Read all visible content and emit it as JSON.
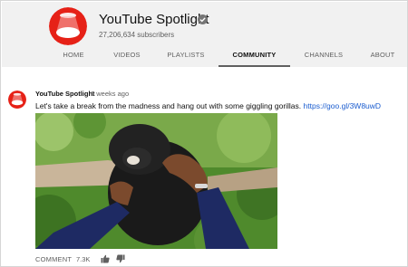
{
  "channel": {
    "name": "YouTube Spotlight",
    "subscribers": "27,206,634 subscribers",
    "verified": true,
    "avatar_icon": "youtube-spotlight-logo",
    "brand_color": "#e62117"
  },
  "tabs": [
    {
      "label": "HOME",
      "active": false
    },
    {
      "label": "VIDEOS",
      "active": false
    },
    {
      "label": "PLAYLISTS",
      "active": false
    },
    {
      "label": "COMMUNITY",
      "active": true
    },
    {
      "label": "CHANNELS",
      "active": false
    },
    {
      "label": "ABOUT",
      "active": false
    }
  ],
  "post": {
    "author": "YouTube Spotlight",
    "time": "2 weeks ago",
    "text": "Let's take a break from the madness and hang out with some giggling gorillas.",
    "link": "https://goo.gl/3W8uwD",
    "image_description_icon": "gorilla-photo",
    "actions": {
      "comment_label": "COMMENT",
      "like_count": "7.3K",
      "like_icon": "thumbs-up-icon",
      "dislike_icon": "thumbs-down-icon"
    }
  }
}
